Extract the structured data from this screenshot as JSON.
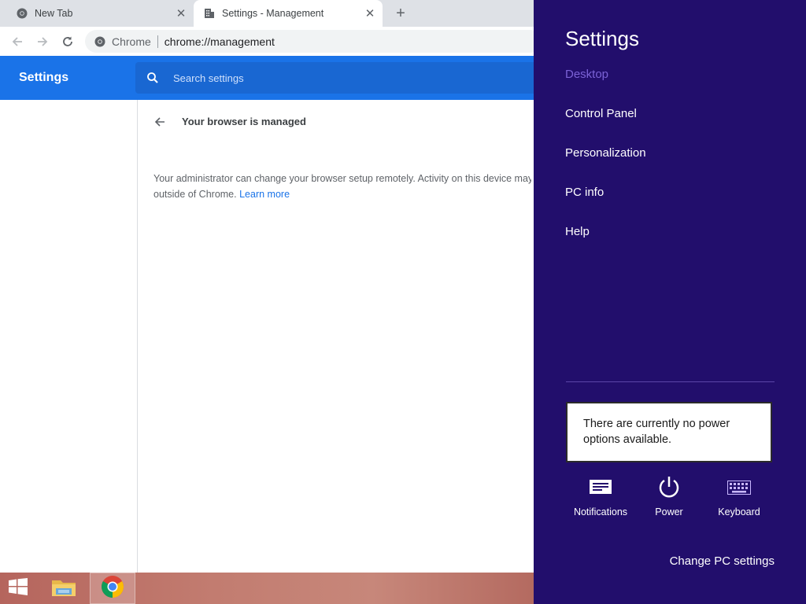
{
  "browser": {
    "tabs": [
      {
        "title": "New Tab",
        "icon": "chrome-icon",
        "active": false
      },
      {
        "title": "Settings - Management",
        "icon": "building-icon",
        "active": true
      }
    ],
    "omnibox": {
      "chip": "Chrome",
      "url": "chrome://management"
    }
  },
  "settings": {
    "app_title": "Settings",
    "search_placeholder": "Search settings",
    "page_heading": "Your browser is managed",
    "body_line1": "Your administrator can change your browser setup remotely. Activity on this device may also be managed",
    "body_line2_prefix": "outside of Chrome.",
    "learn_more": "Learn more"
  },
  "charms": {
    "title": "Settings",
    "context": "Desktop",
    "items": [
      "Control Panel",
      "Personalization",
      "PC info",
      "Help"
    ],
    "tooltip": "There are currently no power options available.",
    "quick": [
      {
        "label": "Notifications",
        "icon": "notifications-icon"
      },
      {
        "label": "Power",
        "icon": "power-icon"
      },
      {
        "label": "Keyboard",
        "icon": "keyboard-icon"
      }
    ],
    "change_pc_settings": "Change PC settings"
  },
  "colors": {
    "charms_bg": "#220e6c",
    "settings_header": "#1a73e8",
    "link": "#1a73e8"
  }
}
